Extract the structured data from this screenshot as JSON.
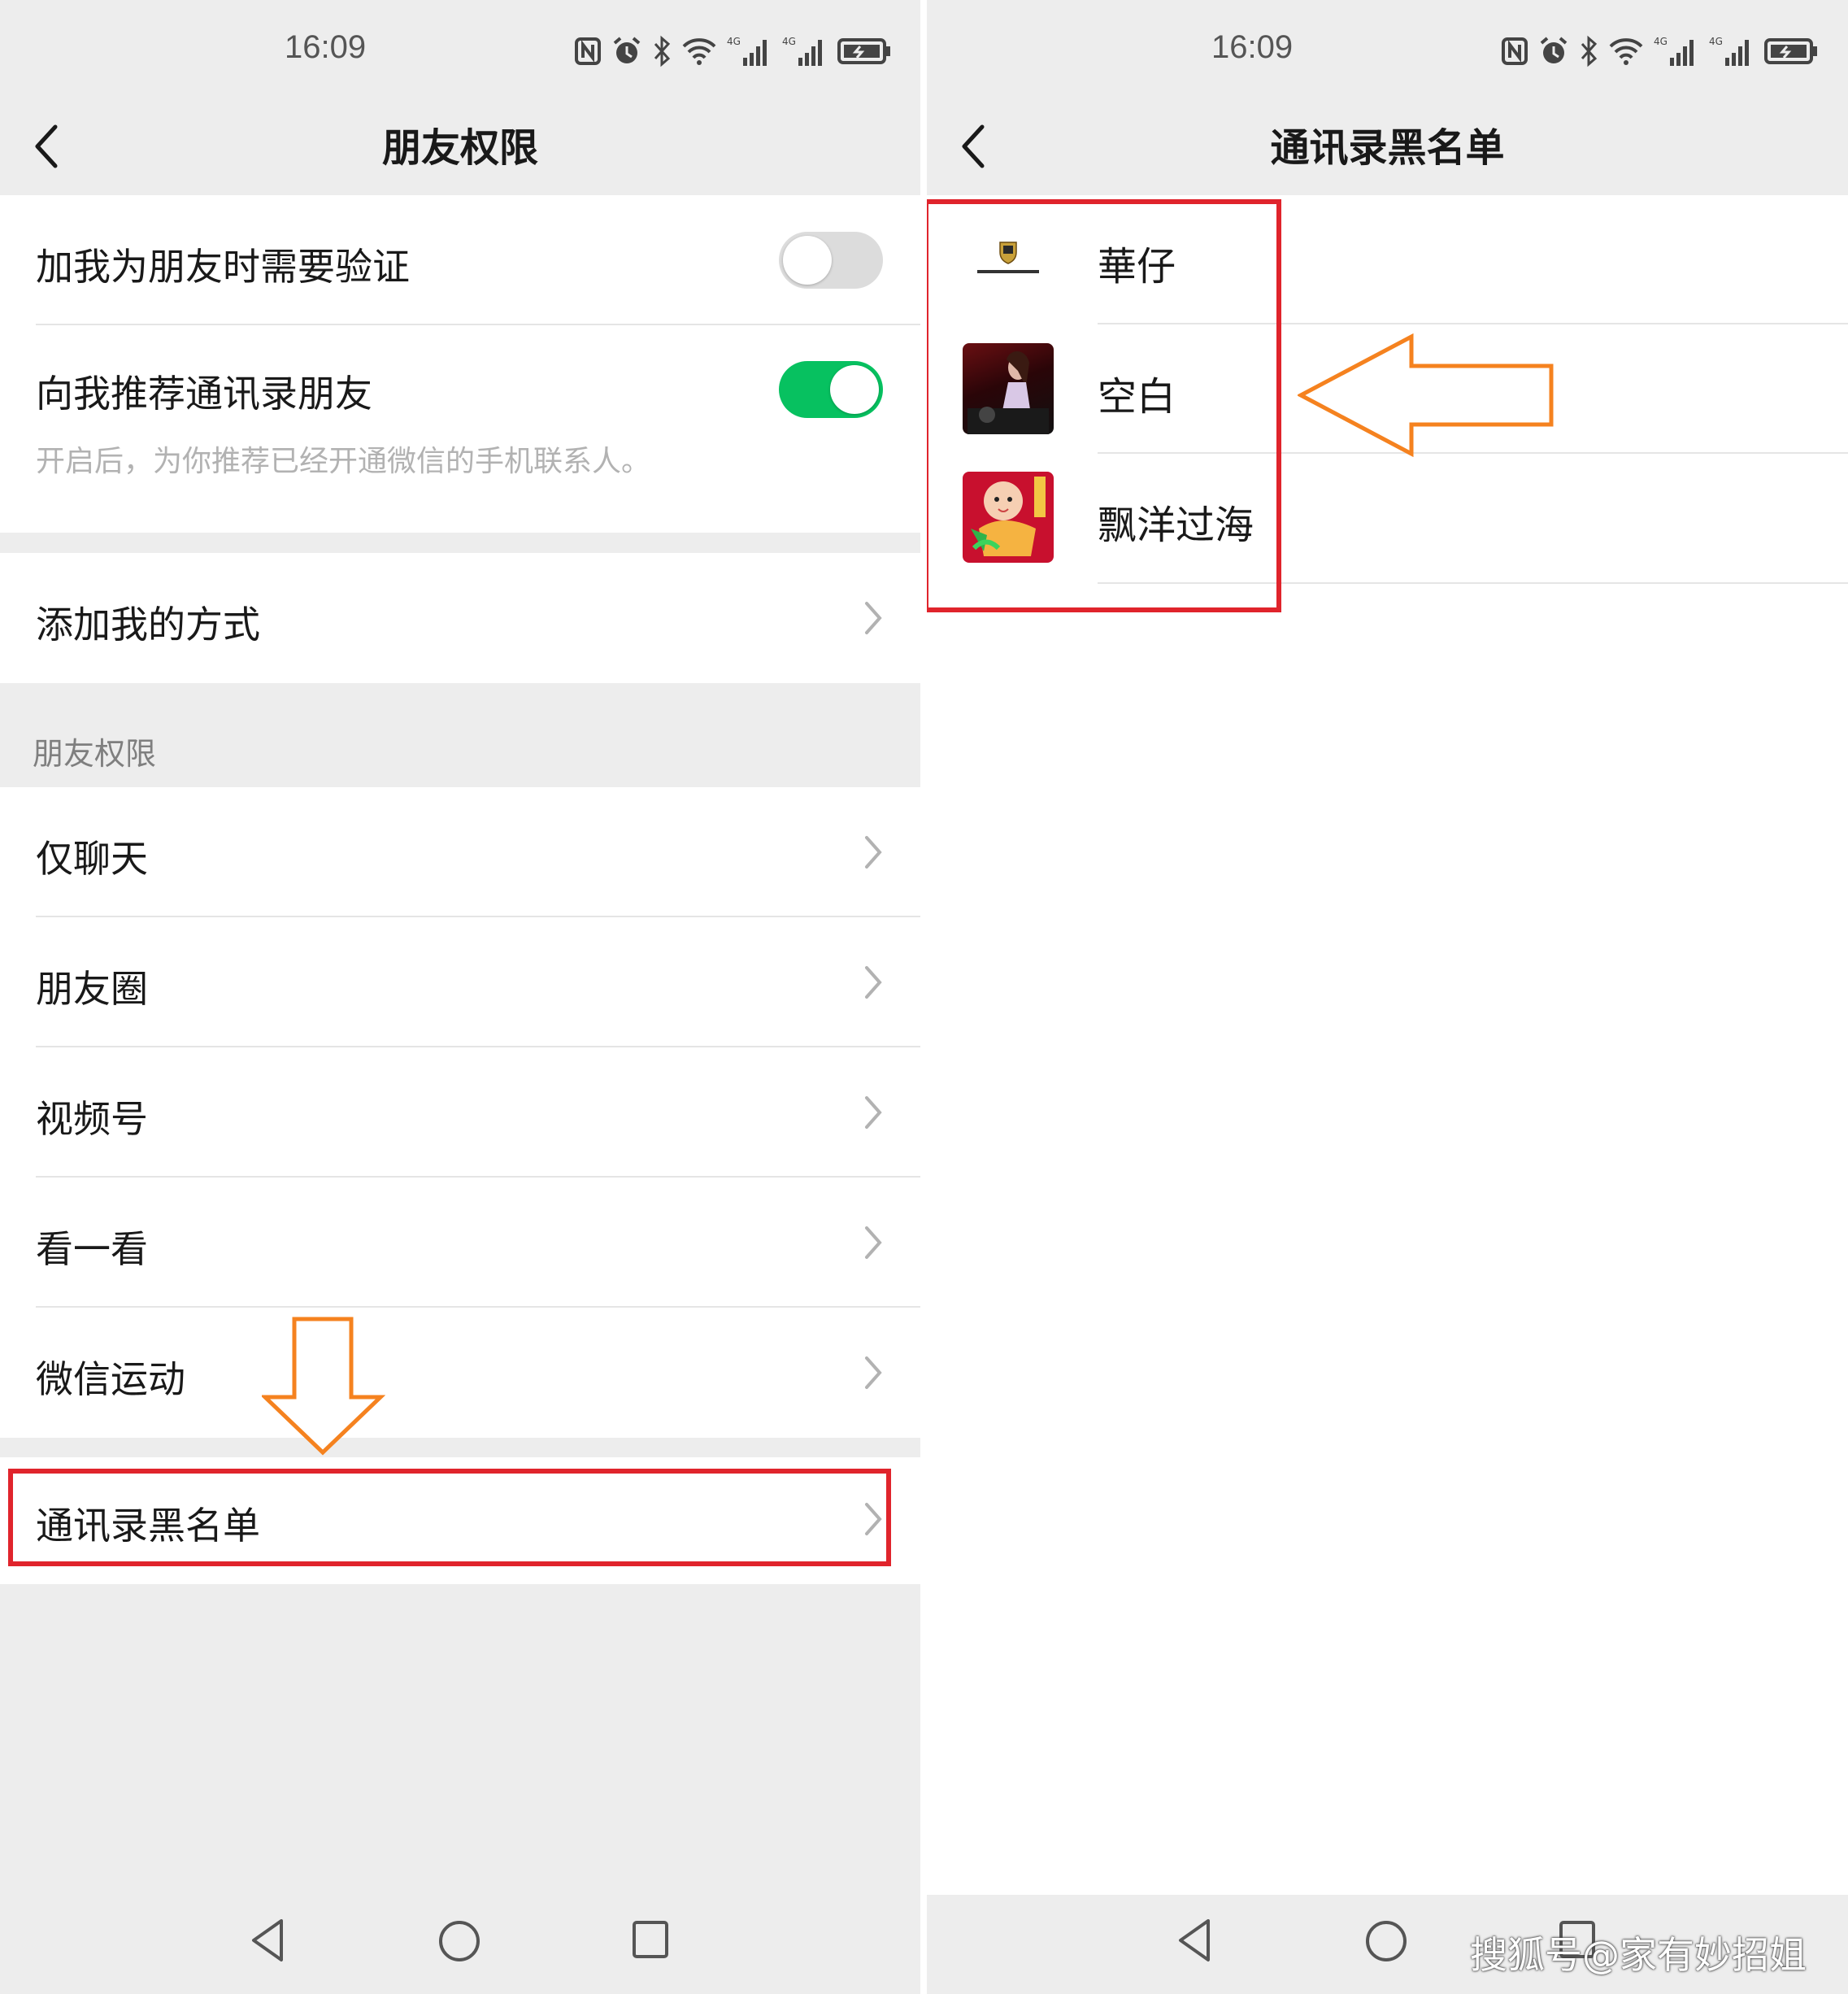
{
  "left": {
    "status": {
      "time": "16:09"
    },
    "nav": {
      "title": "朋友权限"
    },
    "verify_row": {
      "label": "加我为朋友时需要验证",
      "toggle": "off"
    },
    "recommend_row": {
      "label": "向我推荐通讯录朋友",
      "hint": "开启后，为你推荐已经开通微信的手机联系人。",
      "toggle": "on"
    },
    "add_method_row": {
      "label": "添加我的方式"
    },
    "section": {
      "title": "朋友权限"
    },
    "items": [
      {
        "label": "仅聊天"
      },
      {
        "label": "朋友圈"
      },
      {
        "label": "视频号"
      },
      {
        "label": "看一看"
      },
      {
        "label": "微信运动"
      }
    ],
    "blacklist_row": {
      "label": "通讯录黑名单"
    }
  },
  "right": {
    "status": {
      "time": "16:09"
    },
    "nav": {
      "title": "通讯录黑名单"
    },
    "contacts": [
      {
        "name": "華仔",
        "avatar": "porsche-logo"
      },
      {
        "name": "空白",
        "avatar": "person-photo"
      },
      {
        "name": "飘洋过海",
        "avatar": "cartoon-baby"
      }
    ]
  },
  "colors": {
    "wechat_green": "#07c160",
    "highlight_red": "#e0242c",
    "arrow_orange": "#f5821f",
    "page_gray": "#ededed"
  },
  "watermark": {
    "text": "搜狐号@家有妙招姐"
  },
  "icons": [
    "nfc-icon",
    "alarm-icon",
    "bluetooth-icon",
    "wifi-icon",
    "signal-icon",
    "battery-icon",
    "back-icon",
    "chevron-right-icon",
    "back-triangle-icon",
    "home-circle-icon",
    "recent-square-icon"
  ]
}
